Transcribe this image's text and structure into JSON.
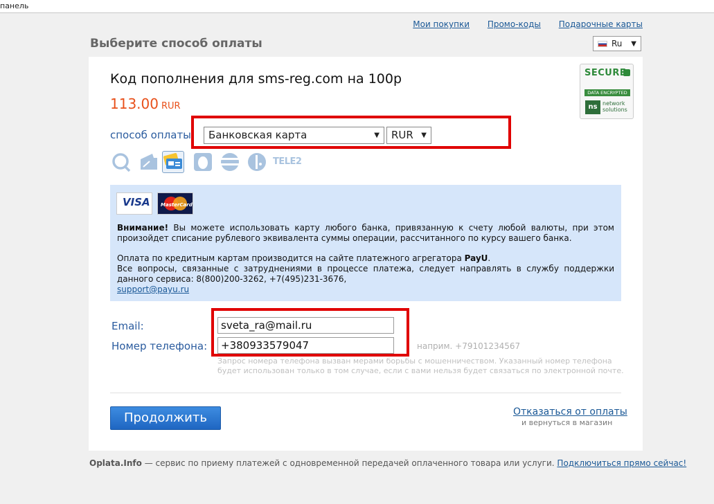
{
  "topbar": {
    "text": "панель"
  },
  "top_links": [
    "Мои покупки",
    "Промо-коды",
    "Подарочные карты"
  ],
  "page_title": "Выберите способ оплаты",
  "language": {
    "selected": "Ru"
  },
  "secure_badge": {
    "title": "SECURE",
    "strip": "DATA ENCRYPTED",
    "brand_line1": "network",
    "brand_line2": "solutions",
    "logo": "ns"
  },
  "product": {
    "title": "Код пополнения для sms-reg.com на 100р",
    "price": "113.00",
    "currency": "RUR"
  },
  "payment": {
    "label": "способ оплаты:",
    "method": "Банковская карта",
    "currency": "RUR",
    "icons": [
      "qiwi-icon",
      "wallet-icon",
      "bank-card-icon",
      "egg-wallet-icon",
      "striped-circle-icon",
      "mobile-operator-icon",
      "tele2-icon"
    ],
    "tele2_label": "TELE2"
  },
  "info": {
    "visa": "VISA",
    "mastercard": "MasterCard",
    "warning_bold": "Внимание!",
    "warning_text": " Вы можете использовать карту любого банка, привязанную к счету любой валюты, при этом произойдет списание рублевого эквивалента суммы операции, рассчитанного по курсу вашего банка.",
    "payu_text": "Оплата по кредитным картам производится на сайте платежного агрегатора ",
    "payu_name": "PayU",
    "payu_end": ".",
    "support_text": "Все вопросы, связанные с затруднениями в процессе платежа, следует направлять в службу поддержки данного сервиса: 8(800)200-3262, +7(495)231-3676,",
    "support_email": "support@payu.ru"
  },
  "form": {
    "email_label": "Email:",
    "email_value": "sveta_ra@mail.ru",
    "phone_label": "Номер телефона:",
    "phone_value": "+380933579047",
    "phone_hint": "наприм. +79101234567",
    "note": "Запрос номера телефона вызван мерами борьбы с мошенничеством. Указанный номер телефона будет использован только в том случае, если с вами нельзя будет связаться по электронной почте."
  },
  "actions": {
    "continue": "Продолжить",
    "cancel": "Отказаться от оплаты",
    "cancel_sub": "и вернуться в магазин"
  },
  "footer": {
    "brand": "Oplata.Info",
    "text": " — сервис по приему платежей с одновременной передачей оплаченного товара или услуги. ",
    "link": "Подключиться прямо сейчас!"
  },
  "colors": {
    "accent_link": "#1a5896",
    "price": "#e8501a",
    "highlight": "#e00000",
    "button": "#1f66c2",
    "info_bg": "#d6e6fa"
  }
}
